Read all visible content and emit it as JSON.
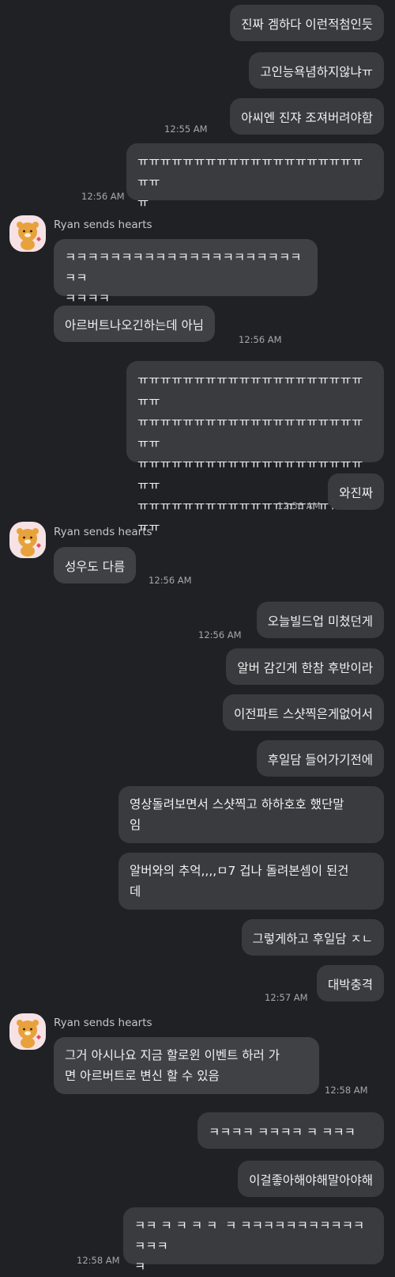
{
  "messages": {
    "m1": "진짜 겜하다 이런적첨인듯",
    "m2": "고인능욕념하지않냐ㅠ",
    "m3": "아씨엔 진쟈 조져버려야함",
    "t1": "12:55 AM",
    "m4": "ㅠㅠㅠㅠㅠㅠㅠㅠㅠㅠㅠㅠㅠㅠㅠㅠㅠㅠㅠㅠㅠㅠ\nㅠ",
    "t2": "12:56 AM",
    "sender1": "Ryan sends hearts",
    "r1": "ㅋㅋㅋㅋㅋㅋㅋㅋㅋㅋㅋㅋㅋㅋㅋㅋㅋㅋㅋㅋㅋㅋㅋ\nㅋㅋㅋㅋ",
    "r2": "아르버트나오긴하는데 아님",
    "t3": "12:56 AM",
    "m5": "ㅠㅠㅠㅠㅠㅠㅠㅠㅠㅠㅠㅠㅠㅠㅠㅠㅠㅠㅠㅠㅠㅠ\nㅠㅠㅠㅠㅠㅠㅠㅠㅠㅠㅠㅠㅠㅠㅠㅠㅠㅠㅠㅠㅠㅠ\nㅠㅠㅠㅠㅠㅠㅠㅠㅠㅠㅠㅠㅠㅠㅠㅠㅠㅠㅠㅠㅠㅠ\nㅠㅠㅠㅠㅠㅠㅠㅠㅠㅠㅠㅠㅠㅠㅠㅠㅠㅠㅠㅠㅠㅠ",
    "m6": "와진짜",
    "t4": "12:56 AM",
    "sender2": "Ryan sends hearts",
    "r3": "성우도 다름",
    "t5": "12:56 AM",
    "m7": "오늘빌드업 미쳤던게",
    "t6": "12:56 AM",
    "m8": "알버 감긴게 한참 후반이라",
    "m9": "이전파트 스샷찍은게없어서",
    "m10": "후일담 들어가기전에",
    "m11": "영상돌려보면서 스샷찍고 하하호호 했단말\n임",
    "m12": "알버와의 추억,,,,ㅁ7 겁나 돌려본셈이 된건\n데",
    "m13": "그렇게하고 후일담 ㅈㄴ",
    "m14": "대박충격",
    "t7": "12:57 AM",
    "sender3": "Ryan sends hearts",
    "r4": "그거 아시나요 지금 할로윈 이벤트 하러 가\n면 아르버트로 변신 할 수 있음",
    "t8": "12:58 AM",
    "m15": "ㅋㅋㅋㅋ ㅋㅋㅋㅋ ㅋ ㅋㅋㅋ",
    "m16": "이걸좋아해야해말아야해",
    "m17": "ㅋㅋ ㅋ ㅋ ㅋ ㅋ  ㅋ ㅋㅋㅋㅋㅋㅋㅋㅋㅋㅋㅋㅋㅋㅋ\nㅋ",
    "t9": "12:58 AM"
  },
  "colors": {
    "background": "#202125",
    "bubble": "#3a3b3f",
    "avatar_bg": "#f6e2e4",
    "ryan": "#e8a23c"
  },
  "icons": {
    "avatar": "ryan-character-icon"
  }
}
